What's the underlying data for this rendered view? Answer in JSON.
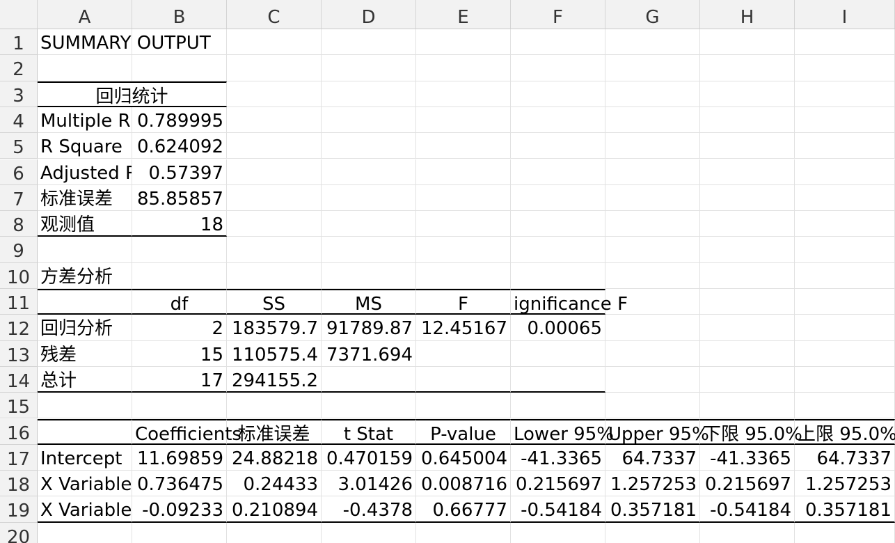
{
  "columns": [
    "A",
    "B",
    "C",
    "D",
    "E",
    "F",
    "G",
    "H",
    "I"
  ],
  "rows": [
    "1",
    "2",
    "3",
    "4",
    "5",
    "6",
    "7",
    "8",
    "9",
    "10",
    "11",
    "12",
    "13",
    "14",
    "15",
    "16",
    "17",
    "18",
    "19",
    "20"
  ],
  "cells": {
    "A1": "SUMMARY OUTPUT",
    "A3": "回归统计",
    "A4": "Multiple R",
    "B4": "0.789995",
    "A5": "R Square",
    "B5": "0.624092",
    "A6": "Adjusted R",
    "B6": "0.57397",
    "A7": "标准误差",
    "B7": "85.85857",
    "A8": "观测值",
    "B8": "18",
    "A10": "方差分析",
    "B11": "df",
    "C11": "SS",
    "D11": "MS",
    "E11": "F",
    "F11": "ignificance F",
    "A12": "回归分析",
    "B12": "2",
    "C12": "183579.7",
    "D12": "91789.87",
    "E12": "12.45167",
    "F12": "0.00065",
    "A13": "残差",
    "B13": "15",
    "C13": "110575.4",
    "D13": "7371.694",
    "A14": "总计",
    "B14": "17",
    "C14": "294155.2",
    "B16": "Coefficients",
    "C16": "标准误差",
    "D16": "t Stat",
    "E16": "P-value",
    "F16": "Lower 95%",
    "G16": "Upper 95%",
    "H16": "下限 95.0%",
    "I16": "上限 95.0%",
    "A17": "Intercept",
    "B17": "11.69859",
    "C17": "24.88218",
    "D17": "0.470159",
    "E17": "0.645004",
    "F17": "-41.3365",
    "G17": "64.7337",
    "H17": "-41.3365",
    "I17": "64.7337",
    "A18": "X Variable",
    "B18": "0.736475",
    "C18": "0.24433",
    "D18": "3.01426",
    "E18": "0.008716",
    "F18": "0.215697",
    "G18": "1.257253",
    "H18": "0.215697",
    "I18": "1.257253",
    "A19": "X Variable",
    "B19": "-0.09233",
    "C19": "0.210894",
    "D19": "-0.4378",
    "E19": "0.66777",
    "F19": "-0.54184",
    "G19": "0.357181",
    "H19": "-0.54184",
    "I19": "0.357181"
  }
}
